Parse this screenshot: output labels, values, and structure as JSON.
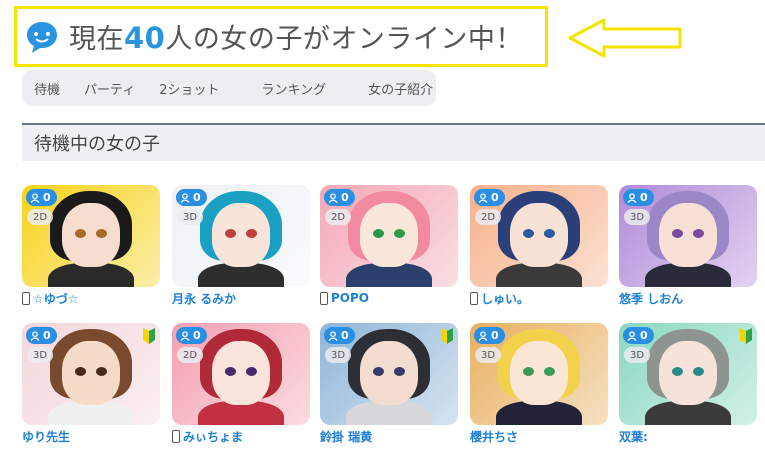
{
  "header": {
    "prefix": "現在",
    "count": "40",
    "suffix": "人の女の子がオンライン中！",
    "accent_color": "#2a94e0",
    "highlight_color": "#f4e400"
  },
  "subnav": {
    "items": [
      "待機",
      "パーティ",
      "2ショット",
      "ランキング",
      "女の子紹介"
    ]
  },
  "section": {
    "title": "待機中の女の子"
  },
  "girls": [
    {
      "name": "☆ゆづ☆",
      "viewers": "0",
      "type": "2D",
      "mobile": true,
      "beginner": false,
      "bg": "#f7d21a",
      "hair": "#1a1a1a",
      "skin": "#f6ddd0",
      "eye": "#a86b2a",
      "body": "#2a2a2a"
    },
    {
      "name": "月永 るみか",
      "viewers": "0",
      "type": "3D",
      "mobile": false,
      "beginner": false,
      "bg": "#eef2f6",
      "hair": "#1aa0c2",
      "skin": "#f9e4da",
      "eye": "#c04040",
      "body": "#2e2e2e"
    },
    {
      "name": "POPO",
      "viewers": "0",
      "type": "2D",
      "mobile": true,
      "beginner": false,
      "bg": "#f3a8b6",
      "hair": "#f28aa0",
      "skin": "#fbe6dc",
      "eye": "#2a9a4a",
      "body": "#2a3f6a"
    },
    {
      "name": "しゅい。",
      "viewers": "0",
      "type": "2D",
      "mobile": true,
      "beginner": false,
      "bg": "#f7b089",
      "hair": "#2b3f78",
      "skin": "#f8e2d6",
      "eye": "#2a5aa0",
      "body": "#3a3a3a"
    },
    {
      "name": "悠季 しおん",
      "viewers": "0",
      "type": "3D",
      "mobile": false,
      "beginner": false,
      "bg": "#b08ad8",
      "hair": "#9b86c6",
      "skin": "#f8e0d6",
      "eye": "#7a4aa0",
      "body": "#2a2a3a"
    },
    {
      "name": "ゆり先生",
      "viewers": "0",
      "type": "3D",
      "mobile": false,
      "beginner": true,
      "bg": "#f4d6dc",
      "hair": "#7a4a2e",
      "skin": "#f6dcc8",
      "eye": "#4a2a1a",
      "body": "#f0f0f0"
    },
    {
      "name": "みぃちょま",
      "viewers": "0",
      "type": "2D",
      "mobile": true,
      "beginner": false,
      "bg": "#f4a0b0",
      "hair": "#b02a3a",
      "skin": "#fbe4dc",
      "eye": "#4a2a6a",
      "body": "#c03040"
    },
    {
      "name": "鈴掛 瑞黄",
      "viewers": "0",
      "type": "3D",
      "mobile": false,
      "beginner": true,
      "bg": "#8fb6d8",
      "hair": "#2e2e36",
      "skin": "#f4dcd0",
      "eye": "#3a3a6a",
      "body": "#d8d8dc"
    },
    {
      "name": "櫻井ちさ",
      "viewers": "0",
      "type": "3D",
      "mobile": false,
      "beginner": false,
      "bg": "#e8b060",
      "hair": "#f2d24a",
      "skin": "#fbe6d6",
      "eye": "#3a9a5a",
      "body": "#222238"
    },
    {
      "name": "双葉:",
      "viewers": "0",
      "type": "3D",
      "mobile": false,
      "beginner": true,
      "bg": "#8ad8c0",
      "hair": "#8e9490",
      "skin": "#f6e2d8",
      "eye": "#2a8a8a",
      "body": "#3a3a3a"
    }
  ]
}
